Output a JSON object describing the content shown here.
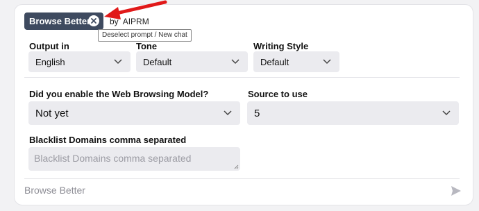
{
  "prompt": {
    "name": "Browse Better",
    "by_label": "by",
    "author": "AIPRM",
    "tooltip": "Deselect prompt / New chat"
  },
  "fields": {
    "output_in": {
      "label": "Output in",
      "value": "English"
    },
    "tone": {
      "label": "Tone",
      "value": "Default"
    },
    "writing_style": {
      "label": "Writing Style",
      "value": "Default"
    },
    "web_browsing": {
      "label": "Did you enable the Web Browsing Model?",
      "value": "Not yet"
    },
    "source": {
      "label": "Source to use",
      "value": "5"
    },
    "blacklist": {
      "label": "Blacklist Domains comma separated",
      "placeholder": "Blacklist Domains comma separated"
    }
  },
  "chat": {
    "placeholder": "Browse Better"
  },
  "colors": {
    "pill": "#3e4a5f",
    "arrow": "#e11919",
    "select_bg": "#ebebef"
  },
  "icons": [
    "close-icon",
    "chevron-down-icon",
    "send-icon",
    "resize-handle-icon",
    "annotation-arrow"
  ]
}
